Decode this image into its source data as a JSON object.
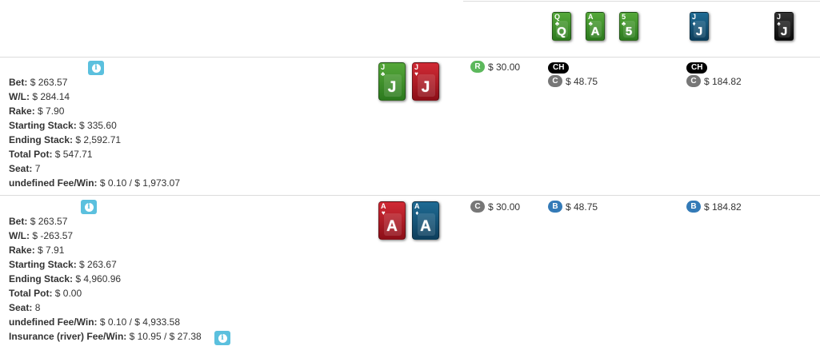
{
  "board": {
    "flop": [
      {
        "rank": "Q",
        "suit": "♣",
        "color": "green"
      },
      {
        "rank": "A",
        "suit": "♣",
        "color": "green"
      },
      {
        "rank": "5",
        "suit": "♣",
        "color": "green"
      }
    ],
    "turn": {
      "rank": "J",
      "suit": "♦",
      "color": "blue"
    },
    "river": {
      "rank": "J",
      "suit": "♠",
      "color": "black"
    }
  },
  "players": [
    {
      "info_icon": "info-icon",
      "bet_label": "Bet:",
      "bet": "$ 263.57",
      "wl_label": "W/L:",
      "wl": "$ 284.14",
      "rake_label": "Rake:",
      "rake": "$ 7.90",
      "start_label": "Starting Stack:",
      "start": "$ 335.60",
      "end_label": "Ending Stack:",
      "end": "$ 2,592.71",
      "pot_label": "Total Pot:",
      "pot": "$ 547.71",
      "seat_label": "Seat:",
      "seat": "7",
      "fee_label": "undefined Fee/Win:",
      "fee": "$ 0.10 / $ 1,973.07",
      "hole": [
        {
          "rank": "J",
          "suit": "♣",
          "color": "green"
        },
        {
          "rank": "J",
          "suit": "♥",
          "color": "red"
        }
      ],
      "preflop": {
        "badge": "R",
        "amount": "$ 30.00"
      },
      "flop": {
        "tag": "CH",
        "badge": "C",
        "amount": "$ 48.75"
      },
      "turn": {
        "tag": "CH",
        "badge": "C",
        "amount": "$ 184.82"
      }
    },
    {
      "info_icon": "info-icon",
      "bet_label": "Bet:",
      "bet": "$ 263.57",
      "wl_label": "W/L:",
      "wl": "$ -263.57",
      "rake_label": "Rake:",
      "rake": "$ 7.91",
      "start_label": "Starting Stack:",
      "start": "$ 263.67",
      "end_label": "Ending Stack:",
      "end": "$ 4,960.96",
      "pot_label": "Total Pot:",
      "pot": "$ 0.00",
      "seat_label": "Seat:",
      "seat": "8",
      "fee_label": "undefined Fee/Win:",
      "fee": "$ 0.10 / $ 4,933.58",
      "ins_label": "Insurance (river) Fee/Win:",
      "ins": "$ 10.95 / $ 27.38",
      "hole": [
        {
          "rank": "A",
          "suit": "♥",
          "color": "red"
        },
        {
          "rank": "A",
          "suit": "♦",
          "color": "blue"
        }
      ],
      "preflop": {
        "badge": "C",
        "amount": "$ 30.00"
      },
      "flop": {
        "badge": "B",
        "amount": "$ 48.75"
      },
      "turn": {
        "badge": "B",
        "amount": "$ 184.82"
      }
    }
  ],
  "colors": {
    "info": "#5bc0de",
    "raise": "#5cb85c",
    "call": "#777777",
    "bet": "#337ab7",
    "check": "#000000"
  }
}
